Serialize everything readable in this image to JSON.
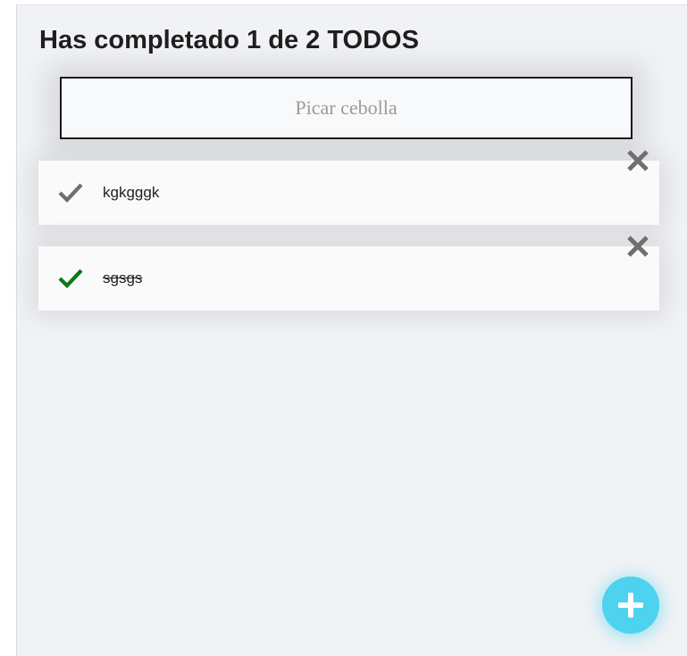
{
  "header": {
    "title": "Has completado 1 de 2 TODOS"
  },
  "new_todo": {
    "placeholder": "Picar cebolla",
    "value": ""
  },
  "todos": [
    {
      "text": "kgkgggk",
      "completed": false,
      "check_icon": "check-icon",
      "delete_icon": "close-icon"
    },
    {
      "text": "sgsgs",
      "completed": true,
      "check_icon": "check-icon",
      "delete_icon": "close-icon"
    }
  ],
  "fab": {
    "icon": "plus-icon"
  },
  "colors": {
    "background": "#f0f2f5",
    "item_background": "#fafafa",
    "check_incomplete": "#6f6f6f",
    "check_complete": "#0a7a14",
    "delete_icon": "#6f6f6f",
    "fab": "#4dd2ef"
  }
}
